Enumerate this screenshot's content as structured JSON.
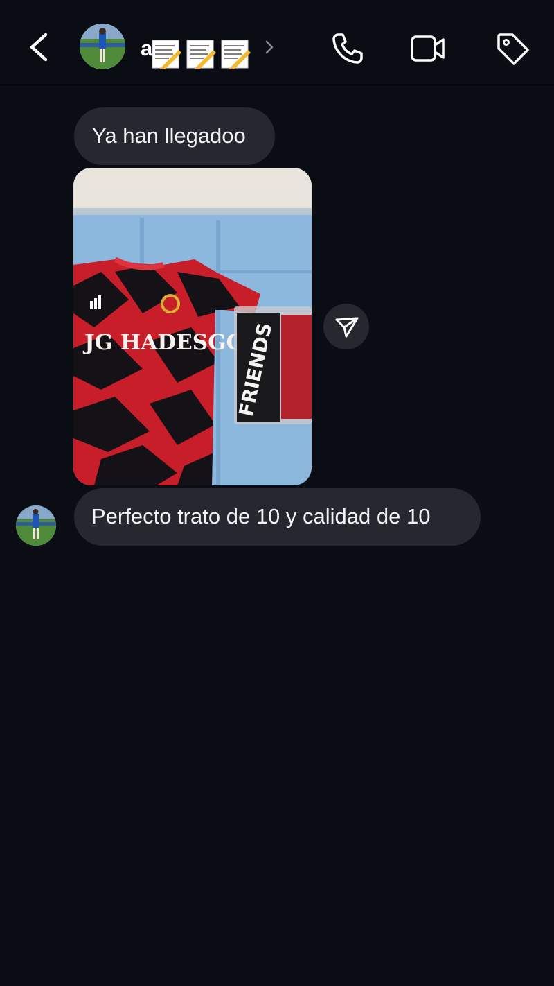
{
  "header": {
    "username": "a",
    "back_icon": "chevron-left-icon",
    "call_icon": "phone-icon",
    "video_icon": "video-camera-icon",
    "tag_icon": "tag-icon"
  },
  "messages": [
    {
      "text": "Ya han llegadoo"
    },
    {
      "text": "Perfecto trato de 10 y calidad de 10"
    }
  ],
  "photo": {
    "jersey_print": "JG HADESGG",
    "package_print": "FRIENDS"
  },
  "colors": {
    "background": "#0b0d15",
    "bubble": "#262830",
    "text": "#f2f3f5"
  }
}
